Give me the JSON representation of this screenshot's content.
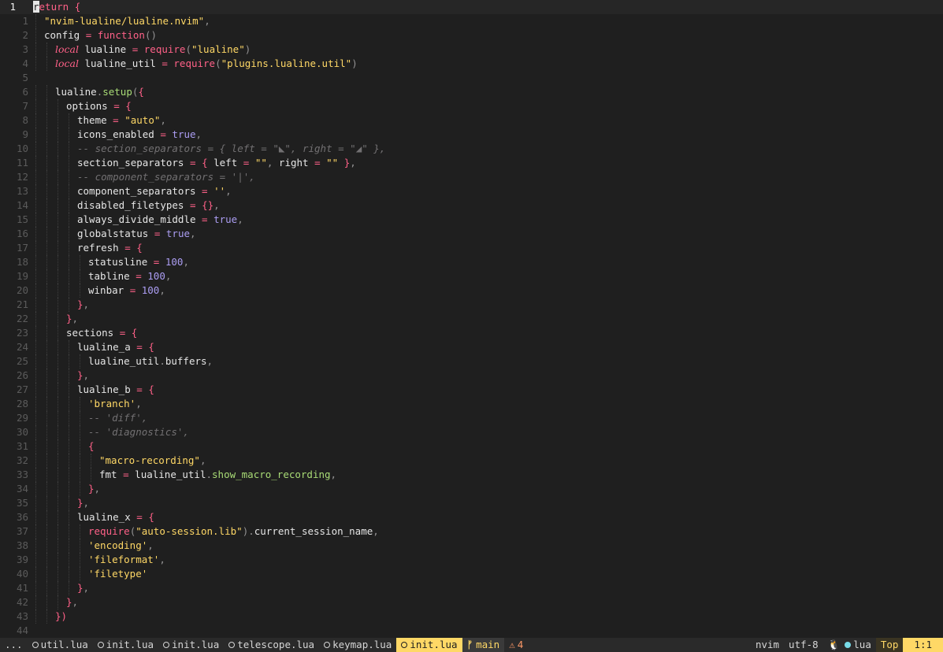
{
  "editor": {
    "current_line_number": "1",
    "lines": [
      {
        "rel": "1",
        "indent": 0,
        "tokens": [
          [
            "kw",
            "return"
          ],
          [
            "id",
            " "
          ],
          [
            "brace",
            "{"
          ]
        ]
      },
      {
        "rel": "1",
        "indent": 1,
        "tokens": [
          [
            "str",
            "\"nvim-lualine/lualine.nvim\""
          ],
          [
            "punc",
            ","
          ]
        ]
      },
      {
        "rel": "2",
        "indent": 1,
        "tokens": [
          [
            "id",
            "config "
          ],
          [
            "op",
            "="
          ],
          [
            "id",
            " "
          ],
          [
            "kw",
            "function"
          ],
          [
            "punc",
            "()"
          ]
        ]
      },
      {
        "rel": "3",
        "indent": 2,
        "tokens": [
          [
            "local",
            "local"
          ],
          [
            "id",
            " lualine "
          ],
          [
            "op",
            "="
          ],
          [
            "id",
            " "
          ],
          [
            "kw",
            "require"
          ],
          [
            "punc",
            "("
          ],
          [
            "str",
            "\"lualine\""
          ],
          [
            "punc",
            ")"
          ]
        ]
      },
      {
        "rel": "4",
        "indent": 2,
        "tokens": [
          [
            "local",
            "local"
          ],
          [
            "id",
            " lualine_util "
          ],
          [
            "op",
            "="
          ],
          [
            "id",
            " "
          ],
          [
            "kw",
            "require"
          ],
          [
            "punc",
            "("
          ],
          [
            "str",
            "\"plugins.lualine.util\""
          ],
          [
            "punc",
            ")"
          ]
        ]
      },
      {
        "rel": "5",
        "indent": 0,
        "tokens": []
      },
      {
        "rel": "6",
        "indent": 2,
        "tokens": [
          [
            "id",
            "lualine"
          ],
          [
            "punc",
            "."
          ],
          [
            "fn",
            "setup"
          ],
          [
            "punc",
            "("
          ],
          [
            "brace",
            "{"
          ]
        ]
      },
      {
        "rel": "7",
        "indent": 3,
        "tokens": [
          [
            "id",
            "options "
          ],
          [
            "op",
            "="
          ],
          [
            "id",
            " "
          ],
          [
            "brace",
            "{"
          ]
        ]
      },
      {
        "rel": "8",
        "indent": 4,
        "tokens": [
          [
            "id",
            "theme "
          ],
          [
            "op",
            "="
          ],
          [
            "id",
            " "
          ],
          [
            "str",
            "\"auto\""
          ],
          [
            "punc",
            ","
          ]
        ]
      },
      {
        "rel": "9",
        "indent": 4,
        "tokens": [
          [
            "id",
            "icons_enabled "
          ],
          [
            "op",
            "="
          ],
          [
            "id",
            " "
          ],
          [
            "bool",
            "true"
          ],
          [
            "punc",
            ","
          ]
        ]
      },
      {
        "rel": "10",
        "indent": 4,
        "tokens": [
          [
            "com",
            "-- section_separators = { left = \"◣\", right = \"◢\" },"
          ]
        ]
      },
      {
        "rel": "11",
        "indent": 4,
        "tokens": [
          [
            "id",
            "section_separators "
          ],
          [
            "op",
            "="
          ],
          [
            "id",
            " "
          ],
          [
            "brace",
            "{"
          ],
          [
            "id",
            " left "
          ],
          [
            "op",
            "="
          ],
          [
            "id",
            " "
          ],
          [
            "str",
            "\"\""
          ],
          [
            "punc",
            ","
          ],
          [
            "id",
            " right "
          ],
          [
            "op",
            "="
          ],
          [
            "id",
            " "
          ],
          [
            "str",
            "\"\""
          ],
          [
            "id",
            " "
          ],
          [
            "brace",
            "}"
          ],
          [
            "punc",
            ","
          ]
        ]
      },
      {
        "rel": "12",
        "indent": 4,
        "tokens": [
          [
            "com",
            "-- component_separators = '|',"
          ]
        ]
      },
      {
        "rel": "13",
        "indent": 4,
        "tokens": [
          [
            "id",
            "component_separators "
          ],
          [
            "op",
            "="
          ],
          [
            "id",
            " "
          ],
          [
            "str",
            "''"
          ],
          [
            "punc",
            ","
          ]
        ]
      },
      {
        "rel": "14",
        "indent": 4,
        "tokens": [
          [
            "id",
            "disabled_filetypes "
          ],
          [
            "op",
            "="
          ],
          [
            "id",
            " "
          ],
          [
            "brace",
            "{}"
          ],
          [
            "punc",
            ","
          ]
        ]
      },
      {
        "rel": "15",
        "indent": 4,
        "tokens": [
          [
            "id",
            "always_divide_middle "
          ],
          [
            "op",
            "="
          ],
          [
            "id",
            " "
          ],
          [
            "bool",
            "true"
          ],
          [
            "punc",
            ","
          ]
        ]
      },
      {
        "rel": "16",
        "indent": 4,
        "tokens": [
          [
            "id",
            "globalstatus "
          ],
          [
            "op",
            "="
          ],
          [
            "id",
            " "
          ],
          [
            "bool",
            "true"
          ],
          [
            "punc",
            ","
          ]
        ]
      },
      {
        "rel": "17",
        "indent": 4,
        "tokens": [
          [
            "id",
            "refresh "
          ],
          [
            "op",
            "="
          ],
          [
            "id",
            " "
          ],
          [
            "brace",
            "{"
          ]
        ]
      },
      {
        "rel": "18",
        "indent": 5,
        "tokens": [
          [
            "id",
            "statusline "
          ],
          [
            "op",
            "="
          ],
          [
            "id",
            " "
          ],
          [
            "num",
            "100"
          ],
          [
            "punc",
            ","
          ]
        ]
      },
      {
        "rel": "19",
        "indent": 5,
        "tokens": [
          [
            "id",
            "tabline "
          ],
          [
            "op",
            "="
          ],
          [
            "id",
            " "
          ],
          [
            "num",
            "100"
          ],
          [
            "punc",
            ","
          ]
        ]
      },
      {
        "rel": "20",
        "indent": 5,
        "tokens": [
          [
            "id",
            "winbar "
          ],
          [
            "op",
            "="
          ],
          [
            "id",
            " "
          ],
          [
            "num",
            "100"
          ],
          [
            "punc",
            ","
          ]
        ]
      },
      {
        "rel": "21",
        "indent": 4,
        "tokens": [
          [
            "brace",
            "}"
          ],
          [
            "punc",
            ","
          ]
        ]
      },
      {
        "rel": "22",
        "indent": 3,
        "tokens": [
          [
            "brace",
            "}"
          ],
          [
            "punc",
            ","
          ]
        ]
      },
      {
        "rel": "23",
        "indent": 3,
        "tokens": [
          [
            "id",
            "sections "
          ],
          [
            "op",
            "="
          ],
          [
            "id",
            " "
          ],
          [
            "brace",
            "{"
          ]
        ]
      },
      {
        "rel": "24",
        "indent": 4,
        "tokens": [
          [
            "id",
            "lualine_a "
          ],
          [
            "op",
            "="
          ],
          [
            "id",
            " "
          ],
          [
            "brace",
            "{"
          ]
        ]
      },
      {
        "rel": "25",
        "indent": 5,
        "tokens": [
          [
            "id",
            "lualine_util"
          ],
          [
            "punc",
            "."
          ],
          [
            "id",
            "buffers"
          ],
          [
            "punc",
            ","
          ]
        ]
      },
      {
        "rel": "26",
        "indent": 4,
        "tokens": [
          [
            "brace",
            "}"
          ],
          [
            "punc",
            ","
          ]
        ]
      },
      {
        "rel": "27",
        "indent": 4,
        "tokens": [
          [
            "id",
            "lualine_b "
          ],
          [
            "op",
            "="
          ],
          [
            "id",
            " "
          ],
          [
            "brace",
            "{"
          ]
        ]
      },
      {
        "rel": "28",
        "indent": 5,
        "tokens": [
          [
            "str",
            "'branch'"
          ],
          [
            "punc",
            ","
          ]
        ]
      },
      {
        "rel": "29",
        "indent": 5,
        "tokens": [
          [
            "com",
            "-- 'diff',"
          ]
        ]
      },
      {
        "rel": "30",
        "indent": 5,
        "tokens": [
          [
            "com",
            "-- 'diagnostics',"
          ]
        ]
      },
      {
        "rel": "31",
        "indent": 5,
        "tokens": [
          [
            "brace",
            "{"
          ]
        ]
      },
      {
        "rel": "32",
        "indent": 6,
        "tokens": [
          [
            "str",
            "\"macro-recording\""
          ],
          [
            "punc",
            ","
          ]
        ]
      },
      {
        "rel": "33",
        "indent": 6,
        "tokens": [
          [
            "id",
            "fmt "
          ],
          [
            "op",
            "="
          ],
          [
            "id",
            " lualine_util"
          ],
          [
            "punc",
            "."
          ],
          [
            "fn",
            "show_macro_recording"
          ],
          [
            "punc",
            ","
          ]
        ]
      },
      {
        "rel": "34",
        "indent": 5,
        "tokens": [
          [
            "brace",
            "}"
          ],
          [
            "punc",
            ","
          ]
        ]
      },
      {
        "rel": "35",
        "indent": 4,
        "tokens": [
          [
            "brace",
            "}"
          ],
          [
            "punc",
            ","
          ]
        ]
      },
      {
        "rel": "36",
        "indent": 4,
        "tokens": [
          [
            "id",
            "lualine_x "
          ],
          [
            "op",
            "="
          ],
          [
            "id",
            " "
          ],
          [
            "brace",
            "{"
          ]
        ]
      },
      {
        "rel": "37",
        "indent": 5,
        "tokens": [
          [
            "kw",
            "require"
          ],
          [
            "punc",
            "("
          ],
          [
            "str",
            "\"auto-session.lib\""
          ],
          [
            "punc",
            ")."
          ],
          [
            "id",
            "current_session_name"
          ],
          [
            "punc",
            ","
          ]
        ]
      },
      {
        "rel": "38",
        "indent": 5,
        "tokens": [
          [
            "str",
            "'encoding'"
          ],
          [
            "punc",
            ","
          ]
        ]
      },
      {
        "rel": "39",
        "indent": 5,
        "tokens": [
          [
            "str",
            "'fileformat'"
          ],
          [
            "punc",
            ","
          ]
        ]
      },
      {
        "rel": "40",
        "indent": 5,
        "tokens": [
          [
            "str",
            "'filetype'"
          ]
        ]
      },
      {
        "rel": "41",
        "indent": 4,
        "tokens": [
          [
            "brace",
            "}"
          ],
          [
            "punc",
            ","
          ]
        ]
      },
      {
        "rel": "42",
        "indent": 3,
        "tokens": [
          [
            "brace",
            "}"
          ],
          [
            "punc",
            ","
          ]
        ]
      },
      {
        "rel": "43",
        "indent": 2,
        "tokens": [
          [
            "brace",
            "})"
          ]
        ]
      },
      {
        "rel": "44",
        "indent": 0,
        "tokens": []
      }
    ]
  },
  "statusline": {
    "ellipsis": "...",
    "buffers": [
      {
        "name": "util.lua",
        "active": false
      },
      {
        "name": "init.lua",
        "active": false
      },
      {
        "name": "init.lua",
        "active": false
      },
      {
        "name": "telescope.lua",
        "active": false
      },
      {
        "name": "keymap.lua",
        "active": false
      },
      {
        "name": "init.lua",
        "active": true
      }
    ],
    "branch": "main",
    "warnings": "4",
    "right": {
      "session": "nvim",
      "encoding": "utf-8",
      "filetype": "lua",
      "progress": "Top",
      "location": "1:1"
    }
  },
  "colors": {
    "accent": "#ffd866",
    "keyword": "#ff6188",
    "string": "#ffd866",
    "number": "#ab9df2",
    "function": "#a9dc76",
    "comment": "#727072",
    "warning": "#fc9867"
  }
}
